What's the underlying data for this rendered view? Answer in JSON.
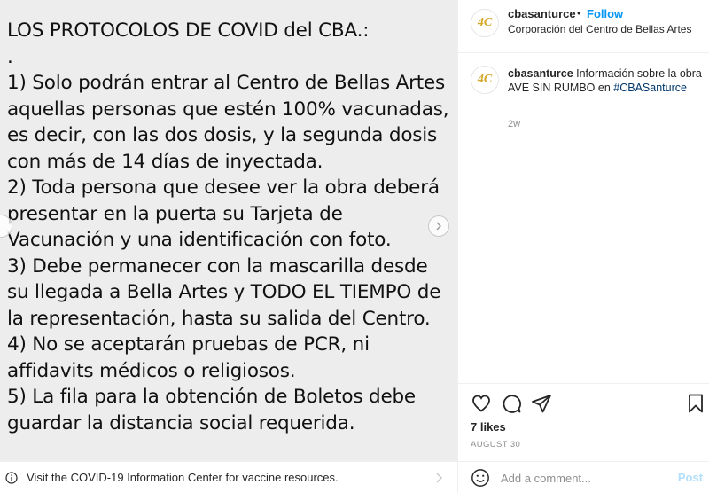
{
  "post": {
    "text_lines": [
      "LOS PROTOCOLOS DE COVID del CBA.:",
      ".",
      "1) Solo podrán entrar al Centro de Bellas Artes",
      "aquellas personas que estén 100% vacunadas,",
      "es decir, con las dos dosis, y la segunda dosis",
      "con más de 14 días de inyectada.",
      "2) Toda persona que desee ver la obra deberá",
      "presentar en la puerta su Tarjeta de",
      "Vacunación y una identificación con foto.",
      "3) Debe permanecer con la mascarilla desde",
      "su llegada a Bella Artes y TODO EL TIEMPO de",
      "la representación, hasta su salida del Centro.",
      "4) No se aceptarán pruebas de PCR, ni",
      "affidavits médicos o religiosos.",
      "5) La fila para la obtención de Boletos debe",
      "guardar la distancia social requerida."
    ]
  },
  "covid_banner": {
    "text": "Visit the COVID-19 Information Center for vaccine resources."
  },
  "header": {
    "avatar_text": "4C",
    "username": "cbasanturce",
    "dot": "•",
    "follow_label": "Follow",
    "subtitle": "Corporación del Centro de Bellas Artes"
  },
  "caption": {
    "avatar_text": "4C",
    "username": "cbasanturce",
    "text": " Información sobre la obra AVE SIN RUMBO en ",
    "hashtag": "#CBASanturce",
    "time": "2w"
  },
  "stats": {
    "likes": "7 likes",
    "date": "AUGUST 30"
  },
  "comment": {
    "placeholder": "Add a comment...",
    "post_label": "Post"
  },
  "icons": {
    "like": "heart-icon",
    "comment": "comment-icon",
    "share": "share-icon",
    "save": "bookmark-icon",
    "emoji": "emoji-icon",
    "info": "info-icon",
    "next": "chevron-right-icon"
  }
}
